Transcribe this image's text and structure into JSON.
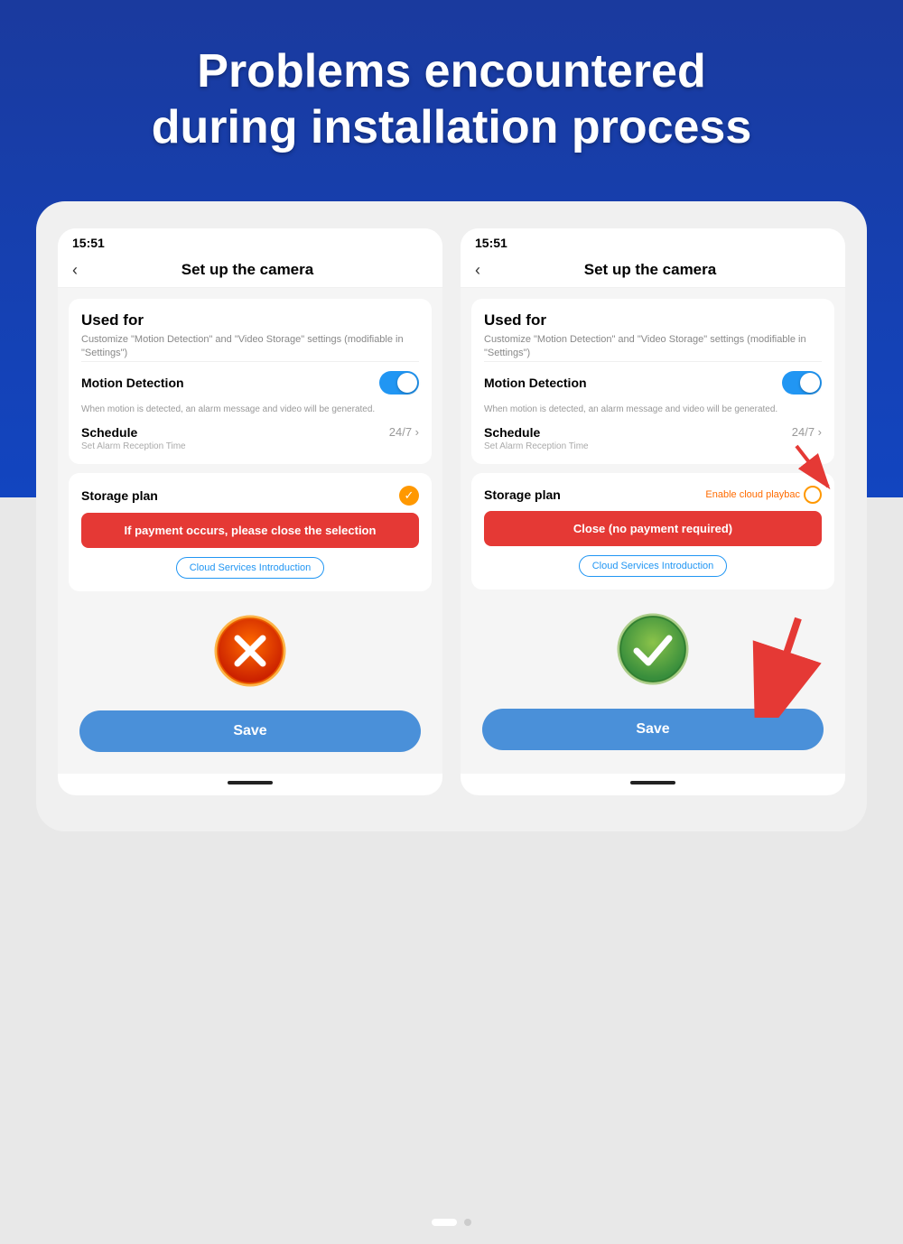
{
  "header": {
    "title_line1": "Problems encountered",
    "title_line2": "during installation process",
    "bg_color": "#1245c0"
  },
  "left_phone": {
    "status_time": "15:51",
    "nav_back": "‹",
    "nav_title": "Set up  the camera",
    "used_for_title": "Used for",
    "used_for_desc": "Customize \"Motion Detection\" and \"Video Storage\" settings (modifiable in \"Settings\")",
    "motion_detection_label": "Motion Detection",
    "motion_note": "When motion is detected, an alarm message and video will be generated.",
    "schedule_label": "Schedule",
    "schedule_value": "24/7 ›",
    "schedule_note": "Set Alarm Reception Time",
    "storage_plan_label": "Storage plan",
    "alert_text": "If payment occurs, please close the selection",
    "cloud_intro_btn": "Cloud Services Introduction",
    "save_label": "Save"
  },
  "right_phone": {
    "status_time": "15:51",
    "nav_back": "‹",
    "nav_title": "Set up  the camera",
    "used_for_title": "Used for",
    "used_for_desc": "Customize \"Motion Detection\" and \"Video Storage\" settings (modifiable in \"Settings\")",
    "motion_detection_label": "Motion Detection",
    "motion_note": "When motion is detected, an alarm message and video will be generated.",
    "schedule_label": "Schedule",
    "schedule_value": "24/7 ›",
    "schedule_note": "Set Alarm Reception Time",
    "storage_plan_label": "Storage plan",
    "enable_cloud_text": "Enable cloud playbac",
    "alert_text": "Close (no payment required)",
    "cloud_intro_btn": "Cloud Services Introduction",
    "save_label": "Save"
  },
  "pagination": {
    "active_index": 0,
    "total": 2
  },
  "icons": {
    "toggle": "toggle-on-icon",
    "check": "check-icon",
    "x_mark": "x-mark-icon",
    "checkmark": "checkmark-icon"
  }
}
